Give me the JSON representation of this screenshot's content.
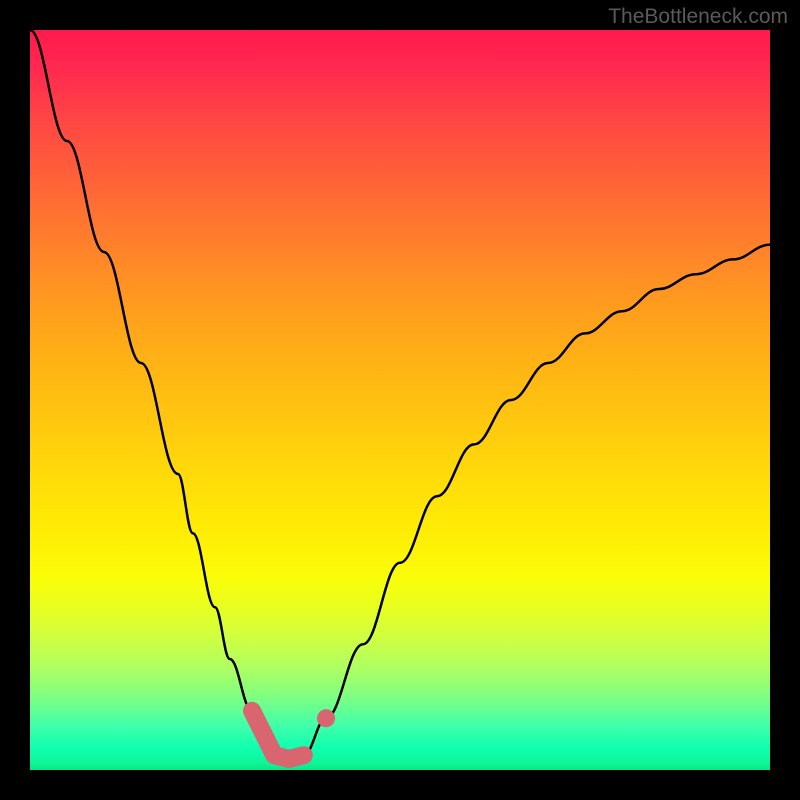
{
  "watermark": "TheBottleneck.com",
  "chart_data": {
    "type": "line",
    "title": "",
    "xlabel": "",
    "ylabel": "",
    "xlim": [
      0,
      100
    ],
    "ylim": [
      0,
      100
    ],
    "x": [
      0,
      5,
      10,
      15,
      20,
      22,
      25,
      27,
      30,
      32,
      33,
      35,
      37,
      40,
      45,
      50,
      55,
      60,
      65,
      70,
      75,
      80,
      85,
      90,
      95,
      100
    ],
    "values": [
      100,
      85,
      70,
      55,
      40,
      32,
      22,
      15,
      8,
      4,
      2,
      1.5,
      2,
      7,
      17,
      28,
      37,
      44,
      50,
      55,
      59,
      62,
      65,
      67,
      69,
      71
    ],
    "marker_points": {
      "x": [
        30,
        32,
        33,
        35,
        37,
        40
      ],
      "values": [
        8,
        4,
        2,
        1.5,
        2,
        7
      ]
    },
    "gradient_annotation": "Background gradient from red (high bottleneck) at top to green (low bottleneck) at bottom"
  }
}
